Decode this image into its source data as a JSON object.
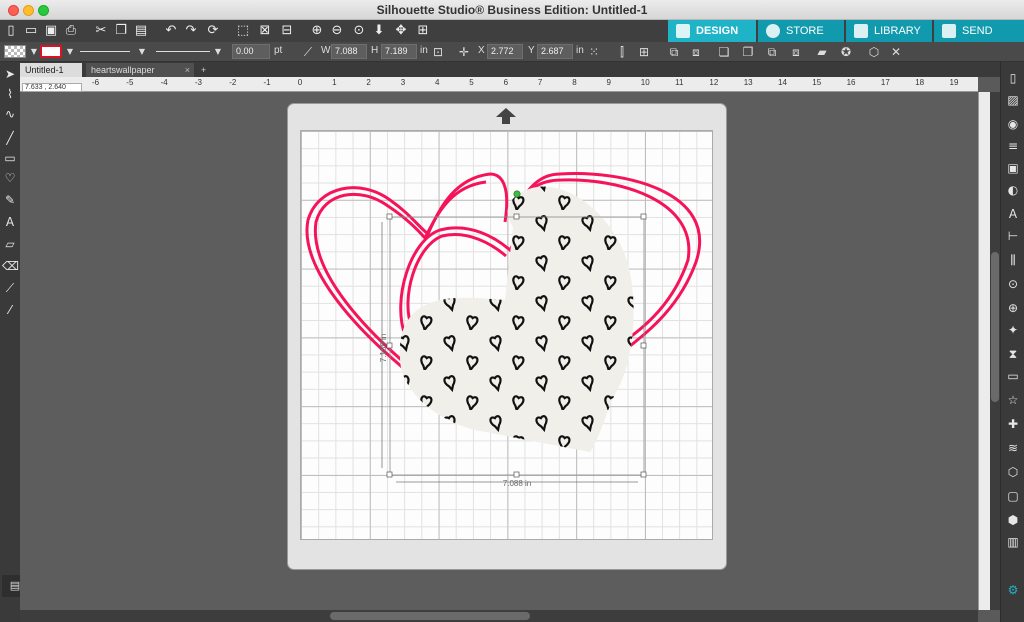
{
  "window": {
    "title": "Silhouette Studio® Business Edition: Untitled-1"
  },
  "nav_tabs": {
    "design": "DESIGN",
    "store": "STORE",
    "library": "LIBRARY",
    "send": "SEND"
  },
  "toolbar2": {
    "line_width_value": "0.00",
    "line_width_unit": "pt",
    "w_label": "W",
    "w_value": "7.088",
    "h_label": "H",
    "h_value": "7.189",
    "size_unit": "in",
    "x_label": "X",
    "x_value": "2.772",
    "y_label": "Y",
    "y_value": "2.687",
    "pos_unit": "in"
  },
  "doc_tabs": {
    "tab1": "Untitled-1",
    "tab2": "heartswallpaper",
    "add": "+"
  },
  "cursor_coords": "7.633 , 2.640",
  "ruler_h_labels": [
    "-6",
    "-5",
    "-4",
    "-3",
    "-2",
    "-1",
    "0",
    "1",
    "2",
    "3",
    "4",
    "5",
    "6",
    "7",
    "8",
    "9",
    "10",
    "11",
    "12",
    "13",
    "14",
    "15",
    "16",
    "17",
    "18",
    "19"
  ],
  "selection": {
    "width_label": "7.088 in",
    "height_label": "7.189 in"
  },
  "colors": {
    "accent": "#1fb3c7",
    "heart_stroke": "#f5145a",
    "pattern_fill": "#f1efe9"
  }
}
